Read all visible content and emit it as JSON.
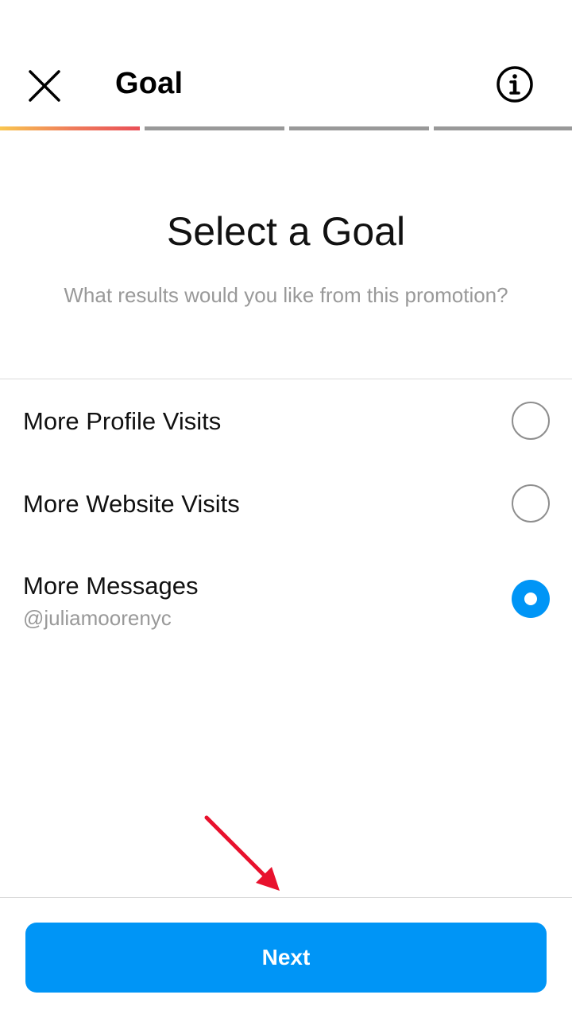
{
  "header": {
    "title": "Goal",
    "close_icon": "close-icon",
    "info_icon": "info-icon"
  },
  "progress": {
    "steps": 4,
    "current_step": 1,
    "active_gradient": [
      "#f9c64f",
      "#ef7e5b",
      "#e94f57"
    ],
    "inactive_color": "#999999"
  },
  "main": {
    "title": "Select a Goal",
    "subtitle": "What results would you like from this promotion?"
  },
  "options": [
    {
      "label": "More Profile Visits",
      "sublabel": "",
      "selected": false
    },
    {
      "label": "More Website Visits",
      "sublabel": "",
      "selected": false
    },
    {
      "label": "More Messages",
      "sublabel": "@juliamoorenyc",
      "selected": true
    }
  ],
  "footer": {
    "next_label": "Next"
  },
  "colors": {
    "accent": "#0095f6",
    "annotation_arrow": "#e8112d"
  }
}
